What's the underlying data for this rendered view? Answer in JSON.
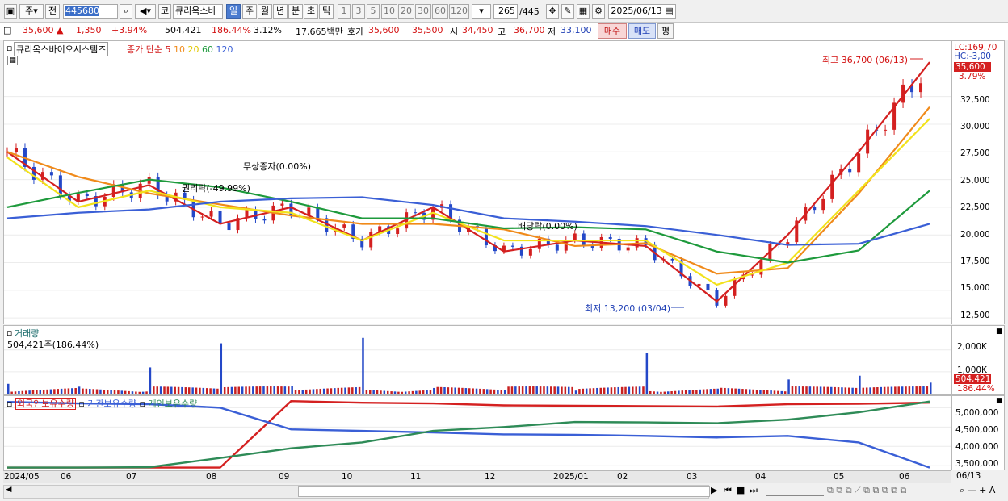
{
  "toolbar": {
    "market": "주",
    "prev": "전",
    "code": "445680",
    "kind": "코",
    "name": "큐리옥스바",
    "periods": [
      "일",
      "주",
      "월",
      "년",
      "분",
      "초",
      "틱"
    ],
    "active_period": "일",
    "intervals": [
      "1",
      "3",
      "5",
      "10",
      "20",
      "30",
      "60",
      "120"
    ],
    "count": "265",
    "count_total": "/445",
    "date": "2025/06/13"
  },
  "quote": {
    "price": "35,600",
    "change": "1,350",
    "change_pct": "+3.94%",
    "volume": "504,421",
    "volume_pct": "186.44%",
    "turnover_pct": "3.12%",
    "amount": "17,665백만",
    "ask_label": "호가",
    "ask": "35,600",
    "bid": "35,500",
    "open_label": "시",
    "open": "34,450",
    "high_label": "고",
    "high": "36,700",
    "low_label": "저",
    "low": "33,100",
    "buy": "매수",
    "sell": "매도",
    "eval": "평"
  },
  "price_panel": {
    "stock_label": "큐리옥스바이오시스템즈",
    "ma_title": "종가 단순",
    "ma_periods": [
      "5",
      "10",
      "20",
      "60",
      "120"
    ],
    "ma_colors": [
      "#d42020",
      "#f08a1a",
      "#f2e21c",
      "#1e9a3c",
      "#3a5fd6"
    ],
    "lc": "LC:169,70",
    "hc": "HC:-3,00",
    "current": "35,600",
    "current_pct": "3.79%",
    "y_ticks": [
      "32,500",
      "30,000",
      "27,500",
      "25,000",
      "22,500",
      "20,000",
      "17,500",
      "15,000",
      "12,500"
    ],
    "high_note": "최고 36,700 (06/13)",
    "low_note": "최저 13,200 (03/04)",
    "event1": "무상증자(0.00%)",
    "event2": "권리락(-49.99%)",
    "event3": "배당락(0.00%)"
  },
  "volume_panel": {
    "title": "거래량",
    "value": "504,421주(186.44%)",
    "y_ticks": [
      "2,000K",
      "1,000K"
    ],
    "current": "504,421",
    "current_pct": "186.44%"
  },
  "holding_panel": {
    "series": [
      "외국인보유수량",
      "기관보유수량",
      "개인보유수량"
    ],
    "series_colors": [
      "#d42020",
      "#3a5fd6",
      "#2e8b57"
    ],
    "y_ticks": [
      "5,000,000",
      "4,500,000",
      "4,000,000",
      "3,500,000"
    ]
  },
  "x_axis": [
    "2024/05",
    "06",
    "07",
    "08",
    "09",
    "10",
    "11",
    "12",
    "2025/01",
    "02",
    "03",
    "04",
    "05",
    "06",
    "06/13"
  ],
  "chart_data": [
    {
      "type": "candlestick",
      "title": "큐리옥스바이오시스템즈",
      "x": [
        "2024/05",
        "06",
        "07",
        "08",
        "09",
        "10",
        "11",
        "12",
        "2025/01",
        "02",
        "03",
        "04",
        "05",
        "06"
      ],
      "close": [
        27500,
        23000,
        24500,
        21000,
        22500,
        19500,
        22500,
        18500,
        19500,
        19000,
        14000,
        20000,
        27500,
        35600
      ],
      "ylim": [
        12000,
        37500
      ],
      "annotations": [
        "최고 36,700 (06/13)",
        "최저 13,200 (03/04)",
        "무상증자(0.00%)",
        "권리락(-49.99%)",
        "배당락(0.00%)"
      ]
    },
    {
      "type": "line",
      "x": [
        "2024/05",
        "06",
        "07",
        "08",
        "09",
        "10",
        "11",
        "12",
        "2025/01",
        "02",
        "03",
        "04",
        "05",
        "06"
      ],
      "series": [
        {
          "name": "20",
          "values": [
            27000,
            22500,
            24000,
            22500,
            22000,
            19500,
            22000,
            19500,
            19500,
            19500,
            15500,
            17500,
            24000,
            30500
          ]
        },
        {
          "name": "60",
          "values": [
            22500,
            23800,
            25000,
            24300,
            23000,
            21500,
            21500,
            20600,
            20700,
            20500,
            18500,
            17500,
            18600,
            24000
          ]
        },
        {
          "name": "120",
          "values": [
            21500,
            22000,
            22300,
            23000,
            23300,
            23400,
            22700,
            21500,
            21200,
            20800,
            20000,
            19100,
            19200,
            21000
          ]
        }
      ]
    },
    {
      "type": "bar",
      "title": "거래량",
      "x": [
        "2024/05",
        "06",
        "07",
        "08",
        "09",
        "10",
        "11",
        "12",
        "2025/01",
        "02",
        "03",
        "04",
        "05",
        "06"
      ],
      "values": [
        450,
        320,
        1200,
        2300,
        350,
        2550,
        260,
        180,
        140,
        1850,
        230,
        650,
        820,
        504
      ],
      "unit": "K"
    },
    {
      "type": "line",
      "x": [
        "2024/05",
        "06",
        "07",
        "08",
        "09",
        "10",
        "11",
        "12",
        "2025/01",
        "02",
        "03",
        "04",
        "05",
        "06"
      ],
      "ylim": [
        3400000,
        5300000
      ],
      "series": [
        {
          "name": "외국인보유수량",
          "values": [
            3450000,
            3450000,
            3450000,
            3450000,
            5170000,
            5130000,
            5110000,
            5060000,
            5050000,
            5040000,
            5030000,
            5090000,
            5100000,
            5130000
          ]
        },
        {
          "name": "기관보유수량",
          "values": [
            5150000,
            5110000,
            5090000,
            5000000,
            4440000,
            4400000,
            4360000,
            4310000,
            4300000,
            4270000,
            4230000,
            4270000,
            4100000,
            3450000
          ]
        },
        {
          "name": "개인보유수량",
          "values": [
            3450000,
            3450000,
            3460000,
            3700000,
            3950000,
            4100000,
            4400000,
            4500000,
            4630000,
            4620000,
            4600000,
            4690000,
            4880000,
            5160000
          ]
        }
      ]
    }
  ]
}
